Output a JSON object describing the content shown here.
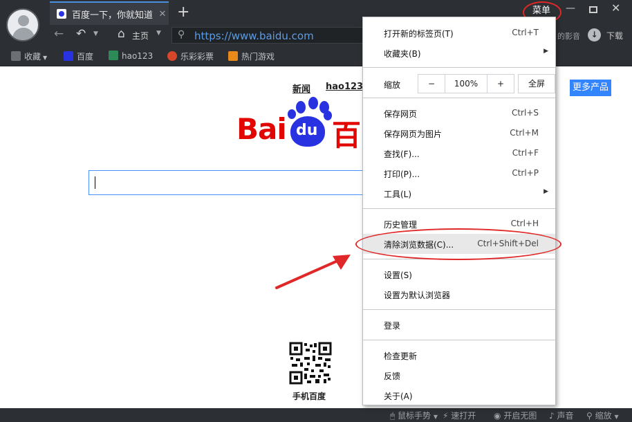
{
  "window": {
    "menu_label": "菜单",
    "min_glyph": "—",
    "close_glyph": "✕"
  },
  "tab": {
    "title": "百度一下，你就知道",
    "close_glyph": "✕",
    "new_tab_glyph": "+"
  },
  "nav": {
    "home_label": "主页",
    "url": "https://www.baidu.com",
    "movie_label": "的影音",
    "download_label": "下载"
  },
  "bookmarks": [
    {
      "label": "收藏",
      "icon": "star-folder-icon",
      "color": "#6c7075"
    },
    {
      "label": "百度",
      "icon": "baidu-paw-icon",
      "color": "#2932e1"
    },
    {
      "label": "hao123",
      "icon": "hao123-icon",
      "color": "#2e8b57"
    },
    {
      "label": "乐彩彩票",
      "icon": "lottery-icon",
      "color": "#d9472b"
    },
    {
      "label": "热门游戏",
      "icon": "game-icon",
      "color": "#e88a1a"
    }
  ],
  "page": {
    "nav_news": "新闻",
    "nav_hao": "hao123",
    "more_products": "更多产品",
    "logo_bai": "Bai",
    "logo_du": "du",
    "logo_cn": "百",
    "qr_label": "手机百度"
  },
  "menu": {
    "new_tab": {
      "label": "打开新的标签页(T)",
      "shortcut": "Ctrl+T"
    },
    "favorites": {
      "label": "收藏夹(B)"
    },
    "zoom": {
      "label": "缩放",
      "minus": "−",
      "value": "100%",
      "plus": "+",
      "fullscreen": "全屏"
    },
    "save_page": {
      "label": "保存网页",
      "shortcut": "Ctrl+S"
    },
    "save_image": {
      "label": "保存网页为图片",
      "shortcut": "Ctrl+M"
    },
    "find": {
      "label": "查找(F)...",
      "shortcut": "Ctrl+F"
    },
    "print": {
      "label": "打印(P)...",
      "shortcut": "Ctrl+P"
    },
    "tools": {
      "label": "工具(L)"
    },
    "history": {
      "label": "历史管理",
      "shortcut": "Ctrl+H"
    },
    "clear_data": {
      "label": "清除浏览数据(C)...",
      "shortcut": "Ctrl+Shift+Del"
    },
    "settings": {
      "label": "设置(S)"
    },
    "default_browser": {
      "label": "设置为默认浏览器"
    },
    "login": {
      "label": "登录"
    },
    "check_update": {
      "label": "检查更新"
    },
    "feedback": {
      "label": "反馈"
    },
    "about": {
      "label": "关于(A)"
    }
  },
  "status": {
    "mouse_gesture": "鼠标手势",
    "quick_open": "速打开",
    "no_image": "开启无图",
    "sound": "声音",
    "zoom": "缩放"
  },
  "colors": {
    "chrome_bg": "#2c2f33",
    "accent_blue": "#3385ff",
    "annotation_red": "#e02828",
    "baidu_red": "#e10601",
    "baidu_blue": "#2932e1"
  }
}
